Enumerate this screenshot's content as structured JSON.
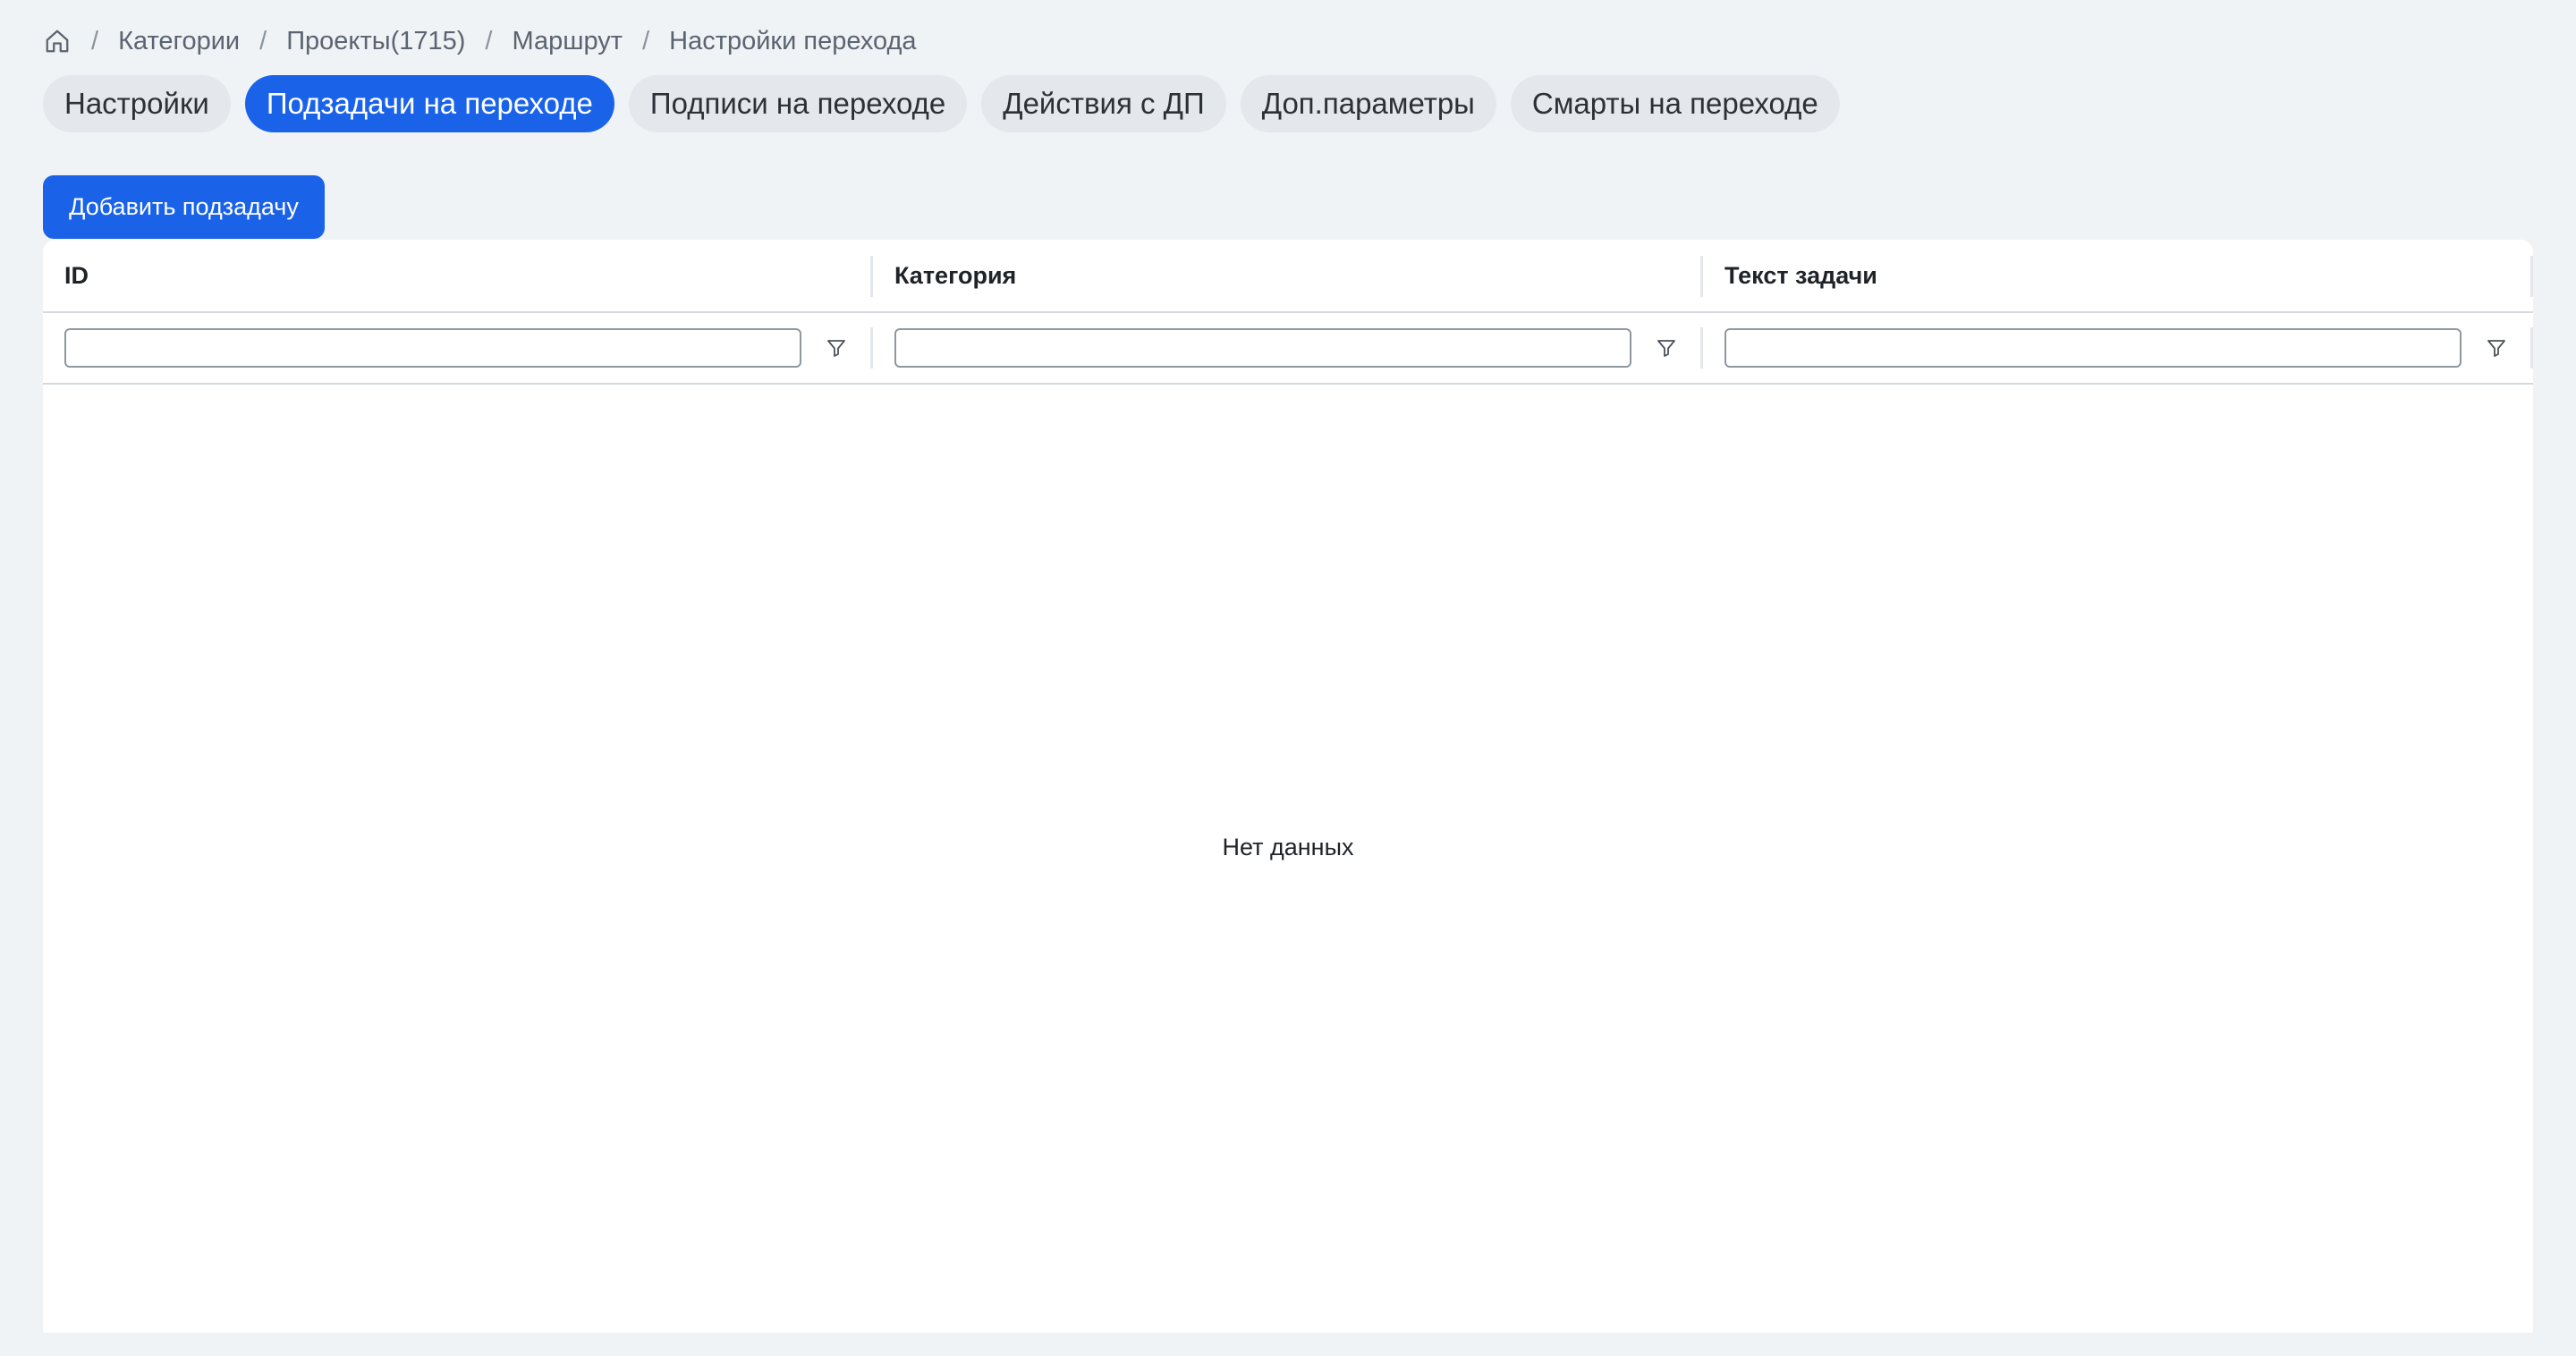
{
  "breadcrumb": {
    "home_icon": "home-icon",
    "items": [
      "Категории",
      "Проекты(1715)",
      "Маршрут",
      "Настройки перехода"
    ],
    "separator": "/"
  },
  "tabs": [
    {
      "label": "Настройки",
      "active": false
    },
    {
      "label": "Подзадачи на переходе",
      "active": true
    },
    {
      "label": "Подписи на переходе",
      "active": false
    },
    {
      "label": "Действия с ДП",
      "active": false
    },
    {
      "label": "Доп.параметры",
      "active": false
    },
    {
      "label": "Смарты на переходе",
      "active": false
    }
  ],
  "add_button": {
    "label": "Добавить подзадачу"
  },
  "table": {
    "columns": [
      "ID",
      "Категория",
      "Текст задачи"
    ],
    "filter_icon": "filter-icon",
    "filter_values": [
      "",
      "",
      ""
    ],
    "empty_text": "Нет данных"
  },
  "colors": {
    "accent": "#1a63e8",
    "background": "#f0f3f6"
  }
}
